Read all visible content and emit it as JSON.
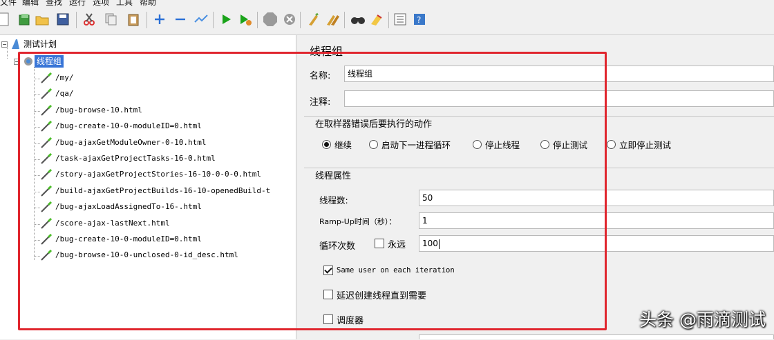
{
  "menubar": {
    "items": [
      "文件",
      "编辑",
      "查找",
      "运行",
      "选项",
      "工具",
      "帮助"
    ]
  },
  "toolbar": {
    "icons": [
      "new-icon",
      "templates-icon",
      "open-icon",
      "save-icon",
      "cut-icon",
      "copy-icon",
      "paste-icon",
      "expand-icon",
      "collapse-icon",
      "toggle-icon",
      "start-icon",
      "start-no-pause-icon",
      "stop-icon",
      "shutdown-icon",
      "clear-icon",
      "clear-all-icon",
      "search-icon",
      "reset-search-icon",
      "function-helper-icon",
      "help-icon"
    ],
    "colors": {
      "start": "#1aa31a",
      "stop": "#9a9a9a"
    }
  },
  "tree": {
    "root": "测试计划",
    "group": "线程组",
    "samplers": [
      "/my/",
      "/qa/",
      "/bug-browse-10.html",
      "/bug-create-10-0-moduleID=0.html",
      "/bug-ajaxGetModuleOwner-0-10.html",
      "/task-ajaxGetProjectTasks-16-0.html",
      "/story-ajaxGetProjectStories-16-10-0-0-0.html",
      "/build-ajaxGetProjectBuilds-16-10-openedBuild-t",
      "/bug-ajaxLoadAssignedTo-16-.html",
      "/score-ajax-lastNext.html",
      "/bug-create-10-0-moduleID=0.html",
      "/bug-browse-10-0-unclosed-0-id_desc.html"
    ]
  },
  "panel": {
    "title": "线程组",
    "name_label": "名称:",
    "name_value": "线程组",
    "comment_label": "注释:",
    "comment_value": "",
    "error_action_title": "在取样器错误后要执行的动作",
    "error_actions": [
      "继续",
      "启动下一进程循环",
      "停止线程",
      "停止测试",
      "立即停止测试"
    ],
    "error_action_selected": 0,
    "thread_props_title": "线程属性",
    "threads_label": "线程数:",
    "threads_value": "50",
    "rampup_label": "Ramp-Up时间（秒）：",
    "rampup_value": "1",
    "loop_label": "循环次数",
    "forever_label": "永远",
    "forever_checked": false,
    "loop_value": "100",
    "same_user_label": "Same user on each iteration",
    "same_user_checked": true,
    "delay_label": "延迟创建线程直到需要",
    "delay_checked": false,
    "scheduler_label": "调度器",
    "scheduler_checked": false
  },
  "watermark": "头条 @雨滴测试",
  "colors": {
    "highlight_box": "#e0262e",
    "selection": "#3875d7"
  }
}
